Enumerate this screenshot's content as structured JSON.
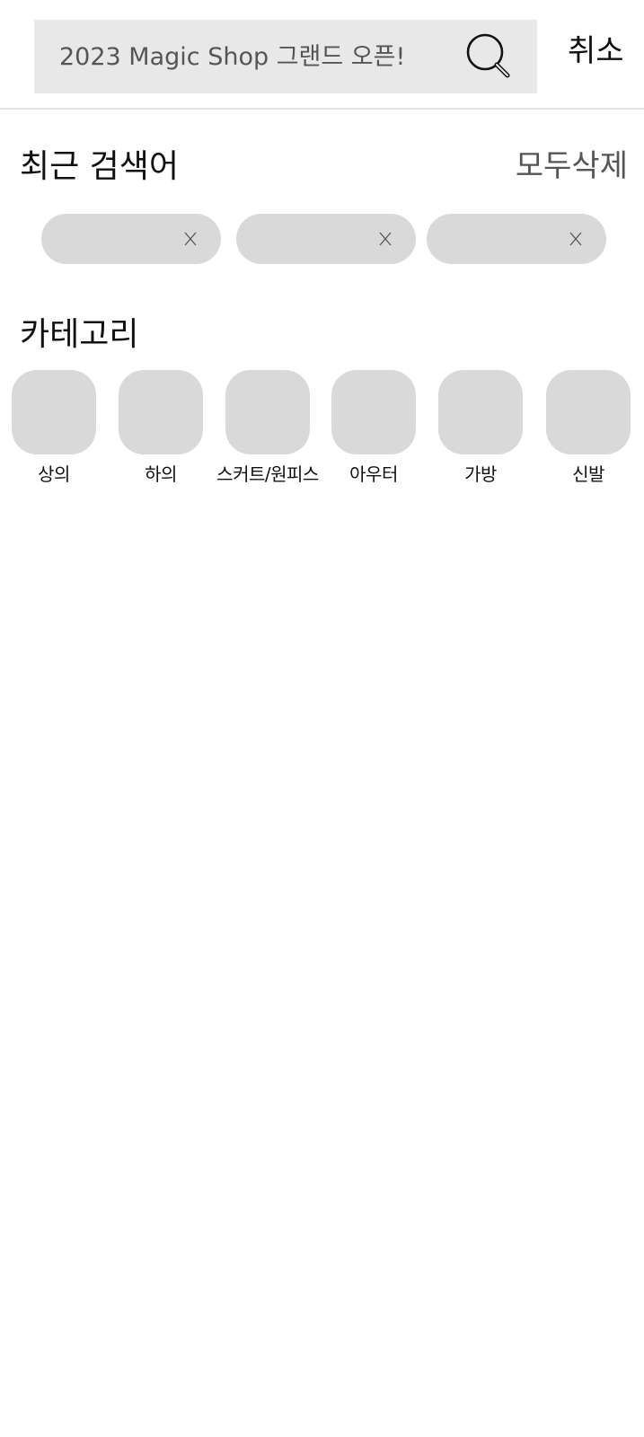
{
  "search": {
    "placeholder": "2023 Magic Shop 그랜드 오픈!",
    "value": "",
    "icon": "search-icon",
    "cancel_label": "취소"
  },
  "recent": {
    "title": "최근 검색어",
    "clear_all_label": "모두삭제",
    "chips": [
      {
        "label": "",
        "remove_label": "X"
      },
      {
        "label": "",
        "remove_label": "X"
      },
      {
        "label": "",
        "remove_label": "X"
      }
    ]
  },
  "categories": {
    "title": "카테고리",
    "items": [
      {
        "label": "상의"
      },
      {
        "label": "하의"
      },
      {
        "label": "스커트/원피스"
      },
      {
        "label": "아우터"
      },
      {
        "label": "가방"
      },
      {
        "label": "신발"
      }
    ]
  },
  "colors": {
    "search_bg": "#e8e8e8",
    "chip_bg": "#d9d9d9",
    "secondary_text": "#555555"
  }
}
